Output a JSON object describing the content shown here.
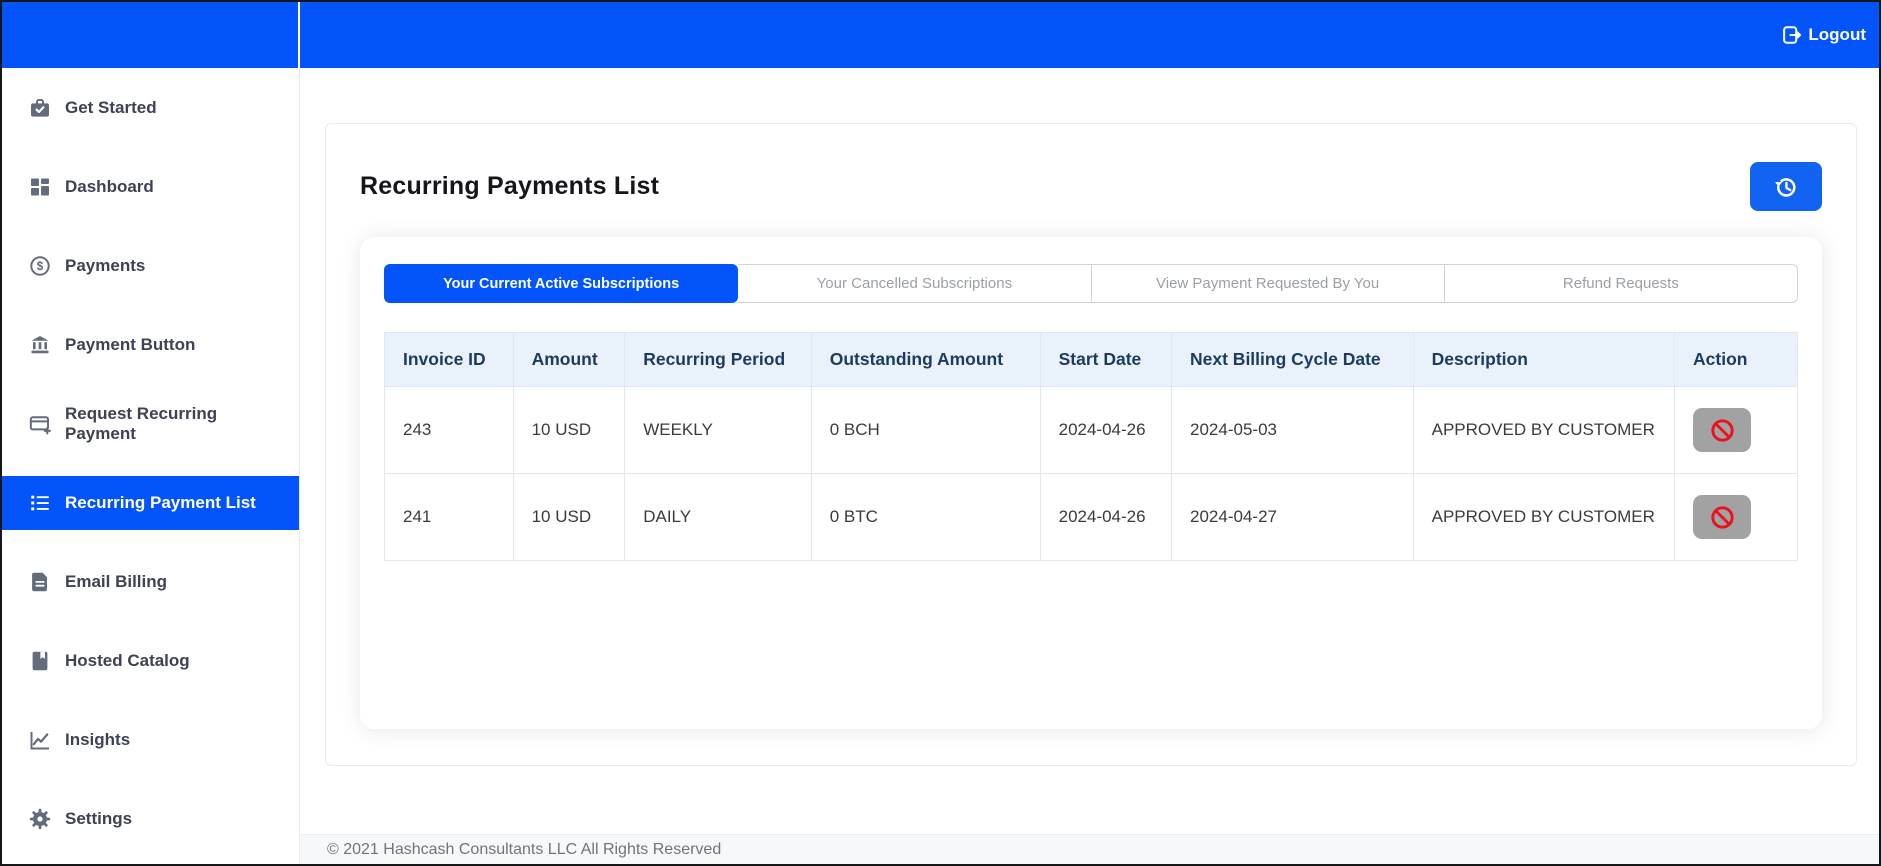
{
  "topbar": {
    "logout_label": "Logout"
  },
  "sidebar": {
    "items": [
      {
        "label": "Get Started",
        "icon": "briefcase-check-icon",
        "active": false
      },
      {
        "label": "Dashboard",
        "icon": "grid-icon",
        "active": false
      },
      {
        "label": "Payments",
        "icon": "dollar-circle-icon",
        "active": false
      },
      {
        "label": "Payment Button",
        "icon": "bank-icon",
        "active": false
      },
      {
        "label": "Request Recurring Payment",
        "icon": "card-plus-icon",
        "active": false
      },
      {
        "label": "Recurring Payment List",
        "icon": "bullet-list-icon",
        "active": true
      },
      {
        "label": "Email Billing",
        "icon": "document-icon",
        "active": false
      },
      {
        "label": "Hosted Catalog",
        "icon": "book-icon",
        "active": false
      },
      {
        "label": "Insights",
        "icon": "line-chart-icon",
        "active": false
      },
      {
        "label": "Settings",
        "icon": "gear-icon",
        "active": false
      }
    ]
  },
  "main": {
    "title": "Recurring Payments List",
    "tabs": [
      {
        "label": "Your Current Active Subscriptions",
        "active": true
      },
      {
        "label": "Your Cancelled Subscriptions",
        "active": false
      },
      {
        "label": "View Payment Requested By You",
        "active": false
      },
      {
        "label": "Refund Requests",
        "active": false
      }
    ],
    "table": {
      "columns": [
        "Invoice ID",
        "Amount",
        "Recurring Period",
        "Outstanding Amount",
        "Start Date",
        "Next Billing Cycle Date",
        "Description",
        "Action"
      ],
      "rows": [
        {
          "invoice_id": "243",
          "amount": "10 USD",
          "recurring_period": "WEEKLY",
          "outstanding_amount": "0 BCH",
          "start_date": "2024-04-26",
          "next_billing_cycle_date": "2024-05-03",
          "description": "APPROVED BY CUSTOMER"
        },
        {
          "invoice_id": "241",
          "amount": "10 USD",
          "recurring_period": "DAILY",
          "outstanding_amount": "0 BTC",
          "start_date": "2024-04-26",
          "next_billing_cycle_date": "2024-04-27",
          "description": "APPROVED BY CUSTOMER"
        }
      ]
    }
  },
  "footer": {
    "copyright": "© 2021 Hashcash Consultants LLC All Rights Reserved"
  },
  "colors": {
    "brand-blue": "#0355fb",
    "refresh-blue": "#1363f2",
    "frame-border": "#14161a",
    "sidebar-text": "#3f4254",
    "icon-gray": "#646c7c",
    "panel-border": "#e7eaf0",
    "tab-border": "#cfd4da",
    "tab-inactive-text": "#9aa0a6",
    "table-header-bg": "#e9f2fb",
    "table-header-text": "#1c3b5e",
    "table-border": "#dfe7ef",
    "cell-text": "#3b3b3b",
    "action-btn-bg": "#a2a2a2",
    "ban-red": "#e8131d",
    "footer-bg": "#f7f8fa",
    "footer-text": "#6c757d"
  }
}
